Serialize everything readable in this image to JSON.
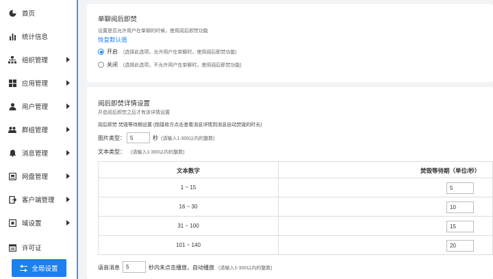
{
  "sidebar": {
    "items": [
      {
        "label": "首页",
        "icon": "home-icon",
        "arrow": false
      },
      {
        "label": "统计信息",
        "icon": "bar-chart-icon",
        "arrow": false
      },
      {
        "label": "组织管理",
        "icon": "org-tree-icon",
        "arrow": true
      },
      {
        "label": "应用管理",
        "icon": "apps-grid-icon",
        "arrow": true
      },
      {
        "label": "用户管理",
        "icon": "user-icon",
        "arrow": true
      },
      {
        "label": "群组管理",
        "icon": "group-icon",
        "arrow": true
      },
      {
        "label": "消息管理",
        "icon": "bell-icon",
        "arrow": true
      },
      {
        "label": "网盘管理",
        "icon": "disk-icon",
        "arrow": true
      },
      {
        "label": "客户端管理",
        "icon": "client-icon",
        "arrow": true
      },
      {
        "label": "域设置",
        "icon": "domain-icon",
        "arrow": true
      },
      {
        "label": "许可证",
        "icon": "license-icon",
        "arrow": false
      }
    ],
    "global_button": "全局设置"
  },
  "burn_chat": {
    "title": "单聊阅后即焚",
    "desc": "设置是否允许用户在单聊的时候，使用阅后即焚功能",
    "reset_link": "恢复默认值",
    "options": [
      {
        "label": "开启",
        "hint": "(选择此选项，允许用户在单聊时，使用阅后即焚功能)",
        "selected": true
      },
      {
        "label": "关闭",
        "hint": "(选择此选项，不允许用户在单聊时，使用阅后即焚功能)",
        "selected": false
      }
    ]
  },
  "burn_detail": {
    "title": "阅后即焚详情设置",
    "desc": "开启阅后即焚之后才有该详情设置",
    "wait_setting": "阅后即焚 焚毁等待期设置 (指接收方点击查看消息详情到消息自动焚毁的时长)",
    "image_label": "图片类型：",
    "image_value": "5",
    "image_unit": "秒",
    "image_hint": "(请输入1-300以内的整数)",
    "text_label": "文本类型：",
    "text_hint": "(请输入1-300以内的整数)",
    "table": {
      "headers": [
        "文本数字",
        "焚毁等待期（单位/秒）"
      ],
      "rows": [
        {
          "range": "1 ~ 15",
          "value": "5"
        },
        {
          "range": "16 ~ 30",
          "value": "10"
        },
        {
          "range": "31 ~ 100",
          "value": "15"
        },
        {
          "range": "101 ~ 140",
          "value": "20"
        }
      ]
    },
    "voice_label": "语音消息",
    "voice_value": "5",
    "voice_suffix": "秒内未点击播放，自动播放",
    "voice_hint": "(请输入1-300以内的整数)"
  },
  "colors": {
    "accent": "#1e7ff0",
    "sidebar_border": "#4a90e2",
    "background": "#f2f3f5"
  }
}
